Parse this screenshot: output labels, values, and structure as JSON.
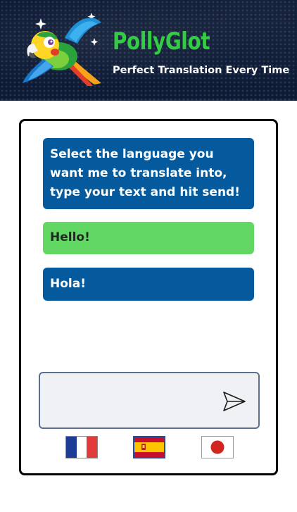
{
  "header": {
    "title": "PollyGlot",
    "subtitle": "Perfect Translation Every Time"
  },
  "chat": {
    "messages": [
      {
        "role": "bot",
        "text": "Select the language you want me to translate into, type your text and hit send!"
      },
      {
        "role": "user",
        "text": "Hello!"
      },
      {
        "role": "bot",
        "text": "Hola!"
      }
    ]
  },
  "composer": {
    "value": "",
    "placeholder": "",
    "send_icon": "send-icon"
  },
  "languages": [
    {
      "code": "fr",
      "icon": "france-flag-icon",
      "selected": false
    },
    {
      "code": "es",
      "icon": "spain-flag-icon",
      "selected": true
    },
    {
      "code": "ja",
      "icon": "japan-flag-icon",
      "selected": false
    }
  ],
  "colors": {
    "header_bg": "#0f1b33",
    "brand_green": "#33cc44",
    "bot_bubble": "#045a9c",
    "user_bubble": "#63d764",
    "composer_bg": "#eff1f5"
  }
}
